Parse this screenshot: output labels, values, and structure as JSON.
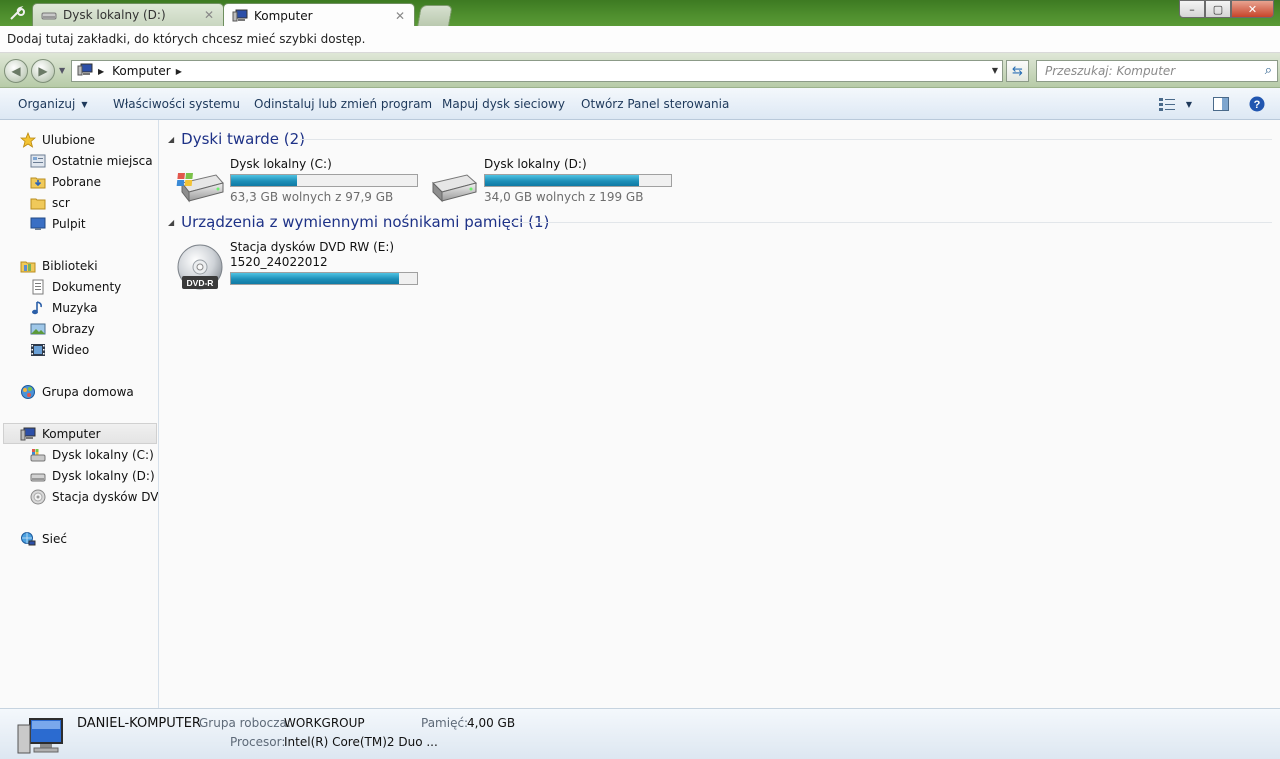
{
  "tabs": [
    {
      "label": "Dysk lokalny (D:)",
      "active": false
    },
    {
      "label": "Komputer",
      "active": true
    }
  ],
  "window_buttons": {
    "minimize": "–",
    "maximize": "▢",
    "close": "✕"
  },
  "bookmarks_bar": {
    "text": "Dodaj tutaj zakładki, do których chcesz mieć szybki dostęp."
  },
  "address": {
    "crumb": "Komputer"
  },
  "search": {
    "placeholder": "Przeszukaj: Komputer"
  },
  "commands": [
    {
      "label": "Organizuj",
      "has_menu": true
    },
    {
      "label": "Właściwości systemu"
    },
    {
      "label": "Odinstaluj lub zmień program"
    },
    {
      "label": "Mapuj dysk sieciowy"
    },
    {
      "label": "Otwórz Panel sterowania"
    }
  ],
  "sidebar": {
    "favorites": {
      "label": "Ulubione",
      "items": [
        "Ostatnie miejsca",
        "Pobrane",
        "scr",
        "Pulpit"
      ]
    },
    "libraries": {
      "label": "Biblioteki",
      "items": [
        "Dokumenty",
        "Muzyka",
        "Obrazy",
        "Wideo"
      ]
    },
    "homegroup": {
      "label": "Grupa domowa"
    },
    "computer": {
      "label": "Komputer",
      "items": [
        "Dysk lokalny (C:)",
        "Dysk lokalny (D:)",
        "Stacja dysków DVD RW (E:)"
      ]
    },
    "network": {
      "label": "Sieć"
    }
  },
  "groups": {
    "hard_drives": {
      "title": "Dyski twarde (2)",
      "drives": [
        {
          "name": "Dysk lokalny (C:)",
          "free_text": "63,3 GB wolnych z 97,9 GB",
          "used_fraction": 0.354
        },
        {
          "name": "Dysk lokalny (D:)",
          "free_text": "34,0 GB wolnych z 199 GB",
          "used_fraction": 0.829
        }
      ]
    },
    "removable": {
      "title": "Urządzenia z wymiennymi nośnikami pamięci (1)",
      "drives": [
        {
          "name": "Stacja dysków DVD RW (E:)",
          "volume_label": "1520_24022012",
          "used_fraction": 0.905,
          "disc_badge": "DVD-R"
        }
      ]
    }
  },
  "details": {
    "computer_name": "DANIEL-KOMPUTER",
    "workgroup_label": "Grupa robocza:",
    "workgroup_value": "WORKGROUP",
    "memory_label": "Pamięć:",
    "memory_value": "4,00 GB",
    "cpu_label": "Procesor:",
    "cpu_value": "Intel(R) Core(TM)2 Duo ..."
  },
  "colors": {
    "accent": "#1e3287",
    "progress": "#1d8fb8",
    "titlebar": "#4f8f2e"
  }
}
